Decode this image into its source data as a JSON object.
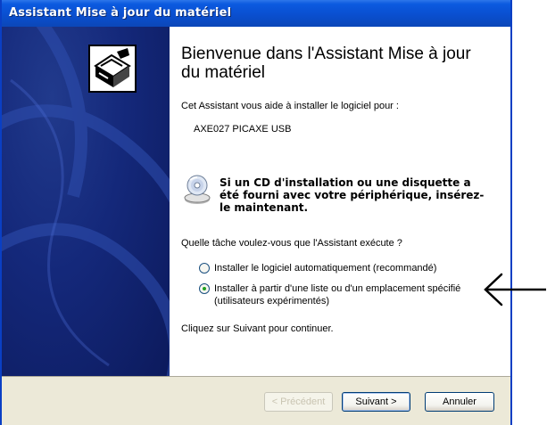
{
  "window": {
    "title": "Assistant Mise à jour du matériel"
  },
  "content": {
    "heading": "Bienvenue dans l'Assistant Mise à jour du matériel",
    "intro": "Cet Assistant vous aide à installer le logiciel pour :",
    "device_name": "AXE027 PICAXE USB",
    "cd_notice": "Si un CD d'installation ou une disquette a été fourni avec votre périphérique, insérez-le maintenant.",
    "question": "Quelle tâche voulez-vous que l'Assistant exécute ?",
    "options": [
      {
        "label": "Installer le logiciel automatiquement (recommandé)",
        "selected": false
      },
      {
        "label": "Installer à partir d'une liste ou d'un emplacement spécifié (utilisateurs expérimentés)",
        "selected": true
      }
    ],
    "footer_text": "Cliquez sur Suivant pour continuer."
  },
  "buttons": {
    "back": "< Précédent",
    "next": "Suivant >",
    "cancel": "Annuler",
    "back_enabled": false
  },
  "colors": {
    "titlebar": "#0a4fd0",
    "side_panel": "#14287a",
    "button_bar": "#ece9d8",
    "radio_dot": "#21a121"
  },
  "icons": [
    "hardware-wizard-icon",
    "cd-icon",
    "pointer-arrow-icon"
  ]
}
